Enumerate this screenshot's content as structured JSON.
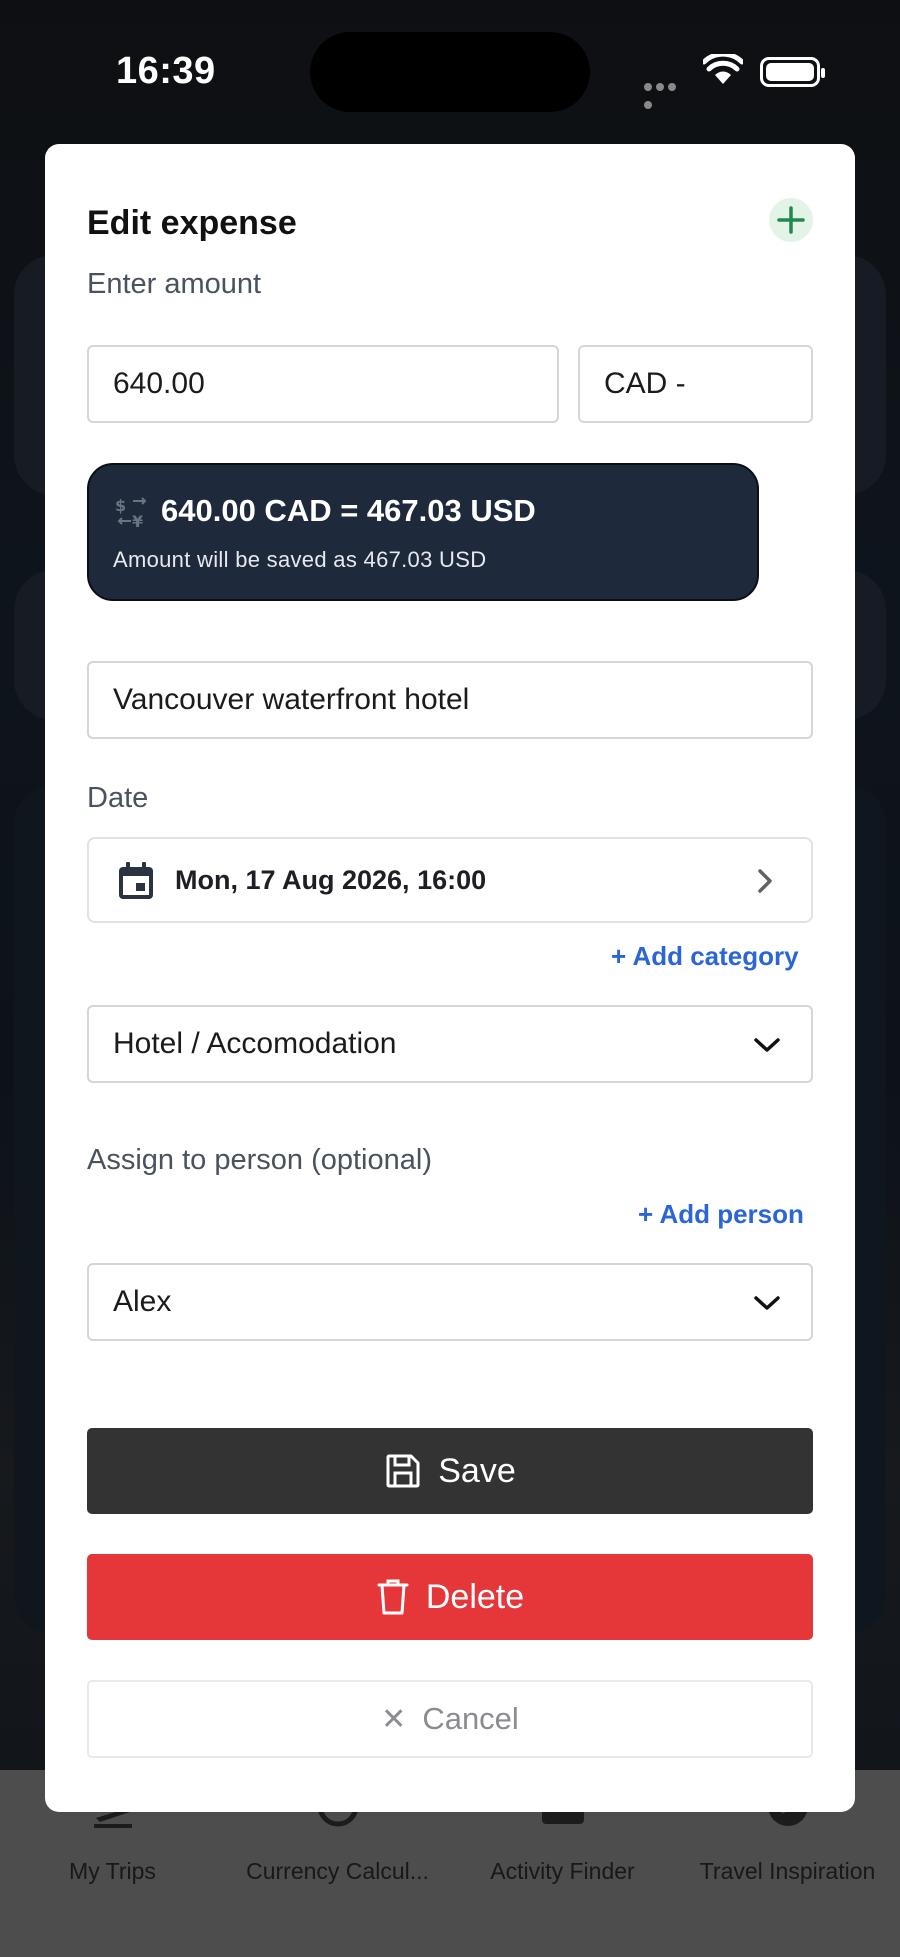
{
  "status_bar": {
    "time": "16:39"
  },
  "modal": {
    "title": "Edit expense",
    "amount_label": "Enter amount",
    "amount_value": "640.00",
    "currency_value": "CAD -",
    "conversion": {
      "main": "640.00 CAD = 467.03 USD",
      "sub": "Amount will be saved as 467.03 USD"
    },
    "description_value": "Vancouver waterfront hotel",
    "date_label": "Date",
    "date_value": "Mon, 17 Aug 2026, 16:00",
    "add_category": "+ Add category",
    "category_value": "Hotel / Accomodation",
    "person_label": "Assign to person (optional)",
    "add_person": "+ Add person",
    "person_value": "Alex",
    "save_label": "Save",
    "delete_label": "Delete",
    "cancel_label": "Cancel"
  },
  "tabbar": {
    "items": [
      {
        "label": "My Trips",
        "icon": "plane-icon"
      },
      {
        "label": "Currency Calcul...",
        "icon": "currency-exchange-icon"
      },
      {
        "label": "Activity Finder",
        "icon": "activity-icon"
      },
      {
        "label": "Travel Inspiration",
        "icon": "compass-icon"
      }
    ]
  },
  "colors": {
    "save_button": "#333333",
    "delete_button": "#e5363a",
    "link": "#2c66d6",
    "conversion_bg": "#1e293b",
    "add_icon": "#1f8a4c"
  }
}
